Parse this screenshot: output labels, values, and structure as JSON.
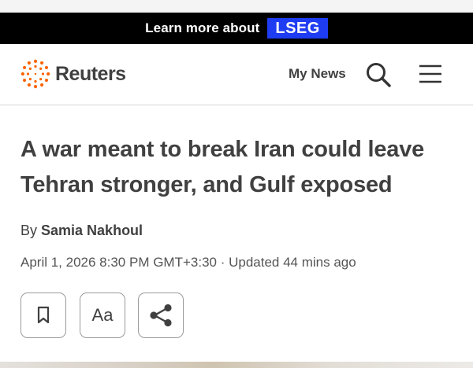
{
  "promo": {
    "text": "Learn more about",
    "badge": "LSEG",
    "badge_color": "#1e3df2"
  },
  "header": {
    "brand": "Reuters",
    "brand_accent_color": "#fa6400",
    "my_news_label": "My News",
    "icons": [
      "reuters-logo-icon",
      "search-icon",
      "menu-icon"
    ]
  },
  "article": {
    "headline": "A war meant to break Iran could leave Tehran stronger, and Gulf exposed",
    "byline_prefix": "By ",
    "author": "Samia Nakhoul",
    "dateline": "April 1, 2026 8:30 PM GMT+3:30 · Updated 44 mins ago"
  },
  "toolbar": {
    "text_size_label": "Aa",
    "icons": [
      "bookmark-icon",
      "text-size-icon",
      "share-icon"
    ]
  }
}
